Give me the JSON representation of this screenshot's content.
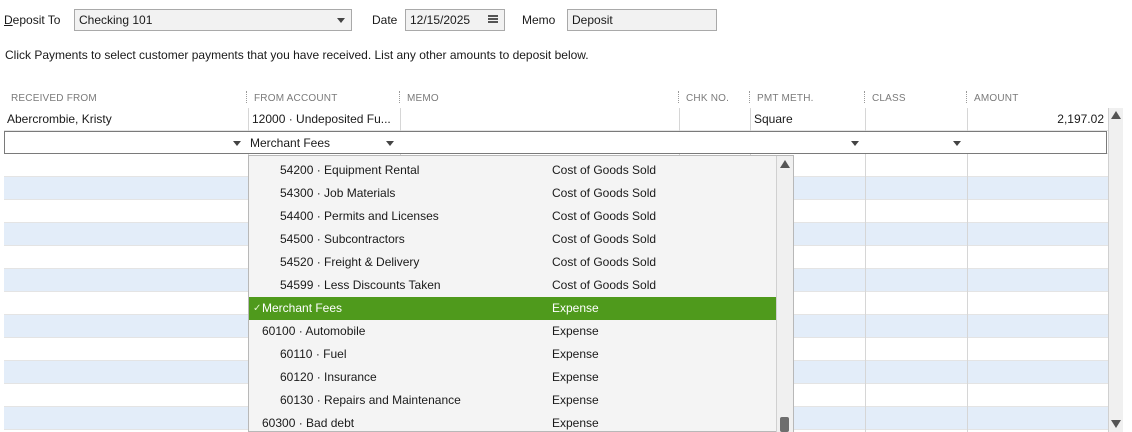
{
  "header": {
    "deposit_to_label": "Deposit To",
    "deposit_to_value": "Checking 101",
    "date_label": "Date",
    "date_value": "12/15/2025",
    "memo_label": "Memo",
    "memo_value": "Deposit"
  },
  "instructions": "Click Payments to select customer payments that you have received. List any other amounts to deposit below.",
  "columns": [
    "RECEIVED FROM",
    "FROM ACCOUNT",
    "MEMO",
    "CHK NO.",
    "PMT METH.",
    "CLASS",
    "AMOUNT"
  ],
  "rows": [
    {
      "received_from": "Abercrombie, Kristy",
      "from_account": "12000 · Undeposited Fu...",
      "memo": "",
      "chk_no": "",
      "pmt_meth": "Square",
      "class": "",
      "amount": "2,197.02"
    }
  ],
  "edit_row": {
    "from_account": "Merchant Fees"
  },
  "dropdown": {
    "items": [
      {
        "name": "54200 · Equipment Rental",
        "type": "Cost of Goods Sold",
        "indent": 1,
        "selected": false
      },
      {
        "name": "54300 · Job Materials",
        "type": "Cost of Goods Sold",
        "indent": 1,
        "selected": false
      },
      {
        "name": "54400 · Permits and Licenses",
        "type": "Cost of Goods Sold",
        "indent": 1,
        "selected": false
      },
      {
        "name": "54500 · Subcontractors",
        "type": "Cost of Goods Sold",
        "indent": 1,
        "selected": false
      },
      {
        "name": "54520 · Freight & Delivery",
        "type": "Cost of Goods Sold",
        "indent": 1,
        "selected": false
      },
      {
        "name": "54599 · Less Discounts Taken",
        "type": "Cost of Goods Sold",
        "indent": 1,
        "selected": false
      },
      {
        "name": "Merchant Fees",
        "type": "Expense",
        "indent": 0,
        "selected": true
      },
      {
        "name": "60100 · Automobile",
        "type": "Expense",
        "indent": 0,
        "selected": false
      },
      {
        "name": "60110 · Fuel",
        "type": "Expense",
        "indent": 1,
        "selected": false
      },
      {
        "name": "60120 · Insurance",
        "type": "Expense",
        "indent": 1,
        "selected": false
      },
      {
        "name": "60130 · Repairs and Maintenance",
        "type": "Expense",
        "indent": 1,
        "selected": false
      },
      {
        "name": "60300 · Bad debt",
        "type": "Expense",
        "indent": 0,
        "selected": false
      }
    ]
  },
  "colors": {
    "selected": "#4f9a1c",
    "stripe": "#e3edf9"
  }
}
